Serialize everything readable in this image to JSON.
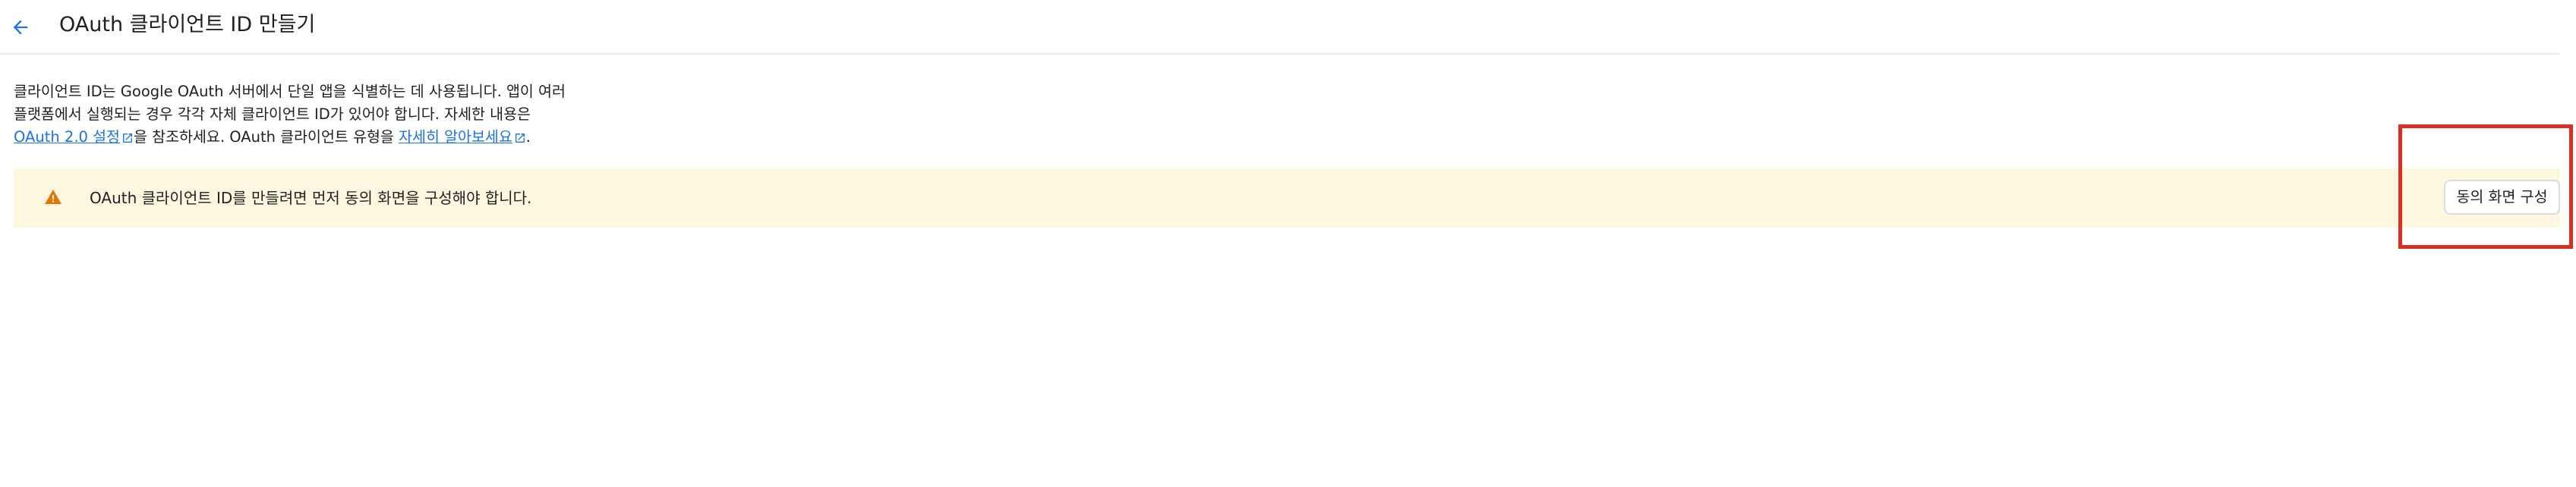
{
  "header": {
    "back_icon": "arrow-back-icon",
    "title": "OAuth 클라이언트 ID 만들기"
  },
  "description": {
    "line1": "클라이언트 ID는 Google OAuth 서버에서 단일 앱을 식별하는 데 사용됩니다. 앱이 여러",
    "line2": "플랫폼에서 실행되는 경우 각각 자체 클라이언트 ID가 있어야 합니다. 자세한 내용은",
    "link1": "OAuth 2.0 설정",
    "text_after_link1": "을 참조하세요. OAuth 클라이언트 유형을 ",
    "link2": "자세히 알아보세요",
    "text_end": "."
  },
  "banner": {
    "warning_icon": "warning-icon",
    "text": "OAuth 클라이언트 ID를 만들려면 먼저 동의 화면을 구성해야 합니다.",
    "button_label": "동의 화면 구성"
  },
  "colors": {
    "link": "#1a73e8",
    "banner_bg": "#fef7e0",
    "warning": "#e37400",
    "highlight": "#d93025"
  }
}
